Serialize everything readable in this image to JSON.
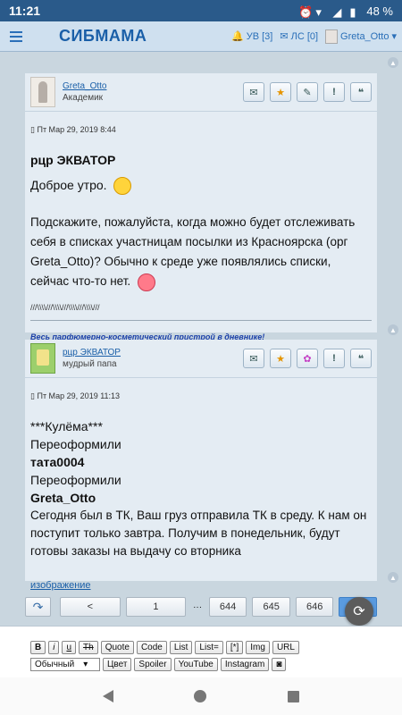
{
  "status": {
    "time": "11:21",
    "battery": "48 %"
  },
  "header": {
    "brand": "СИБМАМА",
    "notif_label": "УВ [3]",
    "pm_label": "ЛС [0]",
    "user": "Greta_Otto"
  },
  "post1": {
    "author": "Greta_Otto",
    "rank": "Академик",
    "date": "Пт Мар 29, 2019 8:44",
    "addressee": "рцр ЭКВАТОР",
    "greeting": "Доброе утро.",
    "question": "Подскажите, пожалуйста, когда можно будет отслеживать себя в списках участницам посылки из Красноярска (орг Greta_Otto)? Обычно к среде уже появлялись списки,",
    "question_end": "сейчас что-то нет.",
    "sig_line": "///\\\\\\\\///\\\\\\\\///\\\\\\\\///\\\\\\\\///",
    "sig_link": "Весь парфюмерно-косметический пристрой в дневнике!"
  },
  "post2": {
    "author": "рцр ЭКВАТОР",
    "rank": "мудрый папа",
    "date": "Пт Мар 29, 2019 11:13",
    "lines": [
      {
        "text": "***Кулёма***",
        "bold": false
      },
      {
        "text": "Переоформили",
        "bold": false
      },
      {
        "text": "тата0004",
        "bold": true
      },
      {
        "text": "Переоформили",
        "bold": false
      },
      {
        "text": "Greta_Otto",
        "bold": true
      }
    ],
    "message": "Сегодня был в ТК, Ваш груз отправила ТК в среду. К нам он поступит только завтра. Получим в понедельник, будут готовы заказы на выдачу со вторника",
    "image_link": "изображение"
  },
  "pager": {
    "prev": "<",
    "first": "1",
    "ellipsis": "···",
    "pages": [
      "644",
      "645",
      "646"
    ]
  },
  "editor": {
    "row1": [
      "B",
      "i",
      "u",
      "Th",
      "Quote",
      "Code",
      "List",
      "List=",
      "[*]",
      "Img",
      "URL"
    ],
    "style_select": "Обычный",
    "row2": [
      "Цвет",
      "Spoiler",
      "YouTube",
      "Instagram"
    ]
  },
  "colors": {
    "statusbar": "#2a5a8a",
    "brand": "#1a5fa8",
    "accent": "#5a9be0"
  }
}
